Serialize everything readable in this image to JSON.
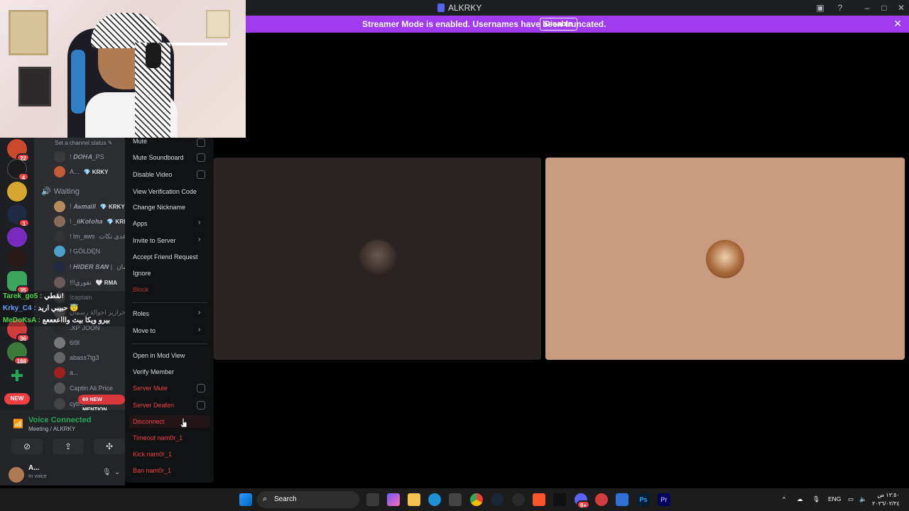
{
  "window": {
    "title": "ALKRKY"
  },
  "banner": {
    "message": "Streamer Mode is enabled. Usernames have been truncated.",
    "disable_label": "Disable"
  },
  "channels": {
    "status_placeholder": "Set a channel status ✎",
    "waiting_label": "Waiting",
    "members": [
      {
        "name": "! 𝑫𝑶𝑯𝑨_PS",
        "tag": ""
      },
      {
        "name": "A...",
        "tag": "💎 KRKY"
      },
      {
        "name": "! 𝑨𝒔𝒎𝒂𝒊𝒍𝒍",
        "tag": "💎 KRKY"
      },
      {
        "name": "! _𝒊𝒊𝑲𝒐𝒕𝒐𝒉𝒂",
        "tag": "💎 KRI"
      },
      {
        "name": "! lm_aws",
        "tag": "عدي نكات"
      },
      {
        "name": "! GÖLDĘN",
        "tag": ""
      },
      {
        "name": "! 𝑯𝑰𝑫𝑬𝑹 𝑺𝑨𝑵 |",
        "tag": "سان"
      },
      {
        "name": "!!!نقوري",
        "tag": "🤍 RMA"
      },
      {
        "name": "!captain",
        "tag": ""
      },
      {
        "name": "خرازير احوالة رسمان",
        "tag": ""
      },
      {
        "name": ".XP`JOON",
        "tag": ""
      },
      {
        "name": "6i9l",
        "tag": ""
      },
      {
        "name": "abass7tg3",
        "tag": ""
      },
      {
        "name": "a...",
        "tag": ""
      },
      {
        "name": "Captin Ali Price",
        "tag": ""
      },
      {
        "name": "cyb...",
        "tag": ""
      }
    ],
    "mention_pill": "69 NEW MENTION"
  },
  "rail": {
    "badges": [
      "22",
      "4",
      "1",
      "35",
      "36",
      "188"
    ],
    "new_label": "NEW"
  },
  "chat_overlay": [
    {
      "user": "Tarek_go5 :",
      "text": "نقطي!"
    },
    {
      "user": "Krky_C4 :",
      "text": "حبيبي اريد 😇"
    },
    {
      "user": "MeDoKsA :",
      "text": "بيرو ويكا بيث واااععععع"
    }
  ],
  "voice": {
    "title": "Voice Connected",
    "subtitle": "Meeting / ALKRKY",
    "user_name": "A...",
    "user_status": "In voice"
  },
  "context_menu": {
    "mute": "Mute",
    "mute_soundboard": "Mute Soundboard",
    "disable_video": "Disable Video",
    "view_verification_code": "View Verification Code",
    "change_nickname": "Change Nickname",
    "apps": "Apps",
    "invite_to_server": "Invite to Server",
    "accept_friend_request": "Accept Friend Request",
    "ignore": "Ignore",
    "block": "Block",
    "roles": "Roles",
    "move_to": "Move to",
    "open_in_mod_view": "Open in Mod View",
    "verify_member": "Verify Member",
    "server_mute": "Server Mute",
    "server_deafen": "Server Deafen",
    "disconnect": "Disconnect",
    "timeout": "Timeout nam0r_1",
    "kick": "Kick nam0r_1",
    "ban": "Ban nam0r_1"
  },
  "taskbar": {
    "search_label": "Search",
    "language": "ENG",
    "time": "١٢:٥٠ ص",
    "date": "٢٠٢٦/٠٢/٢٤",
    "discord_badge": "9+"
  },
  "colors": {
    "banner": "#a03bf0",
    "voice_connected": "#23a55a",
    "danger": "#f23f43",
    "tile_dark": "#2a2522",
    "tile_peach": "#c89a7e"
  }
}
